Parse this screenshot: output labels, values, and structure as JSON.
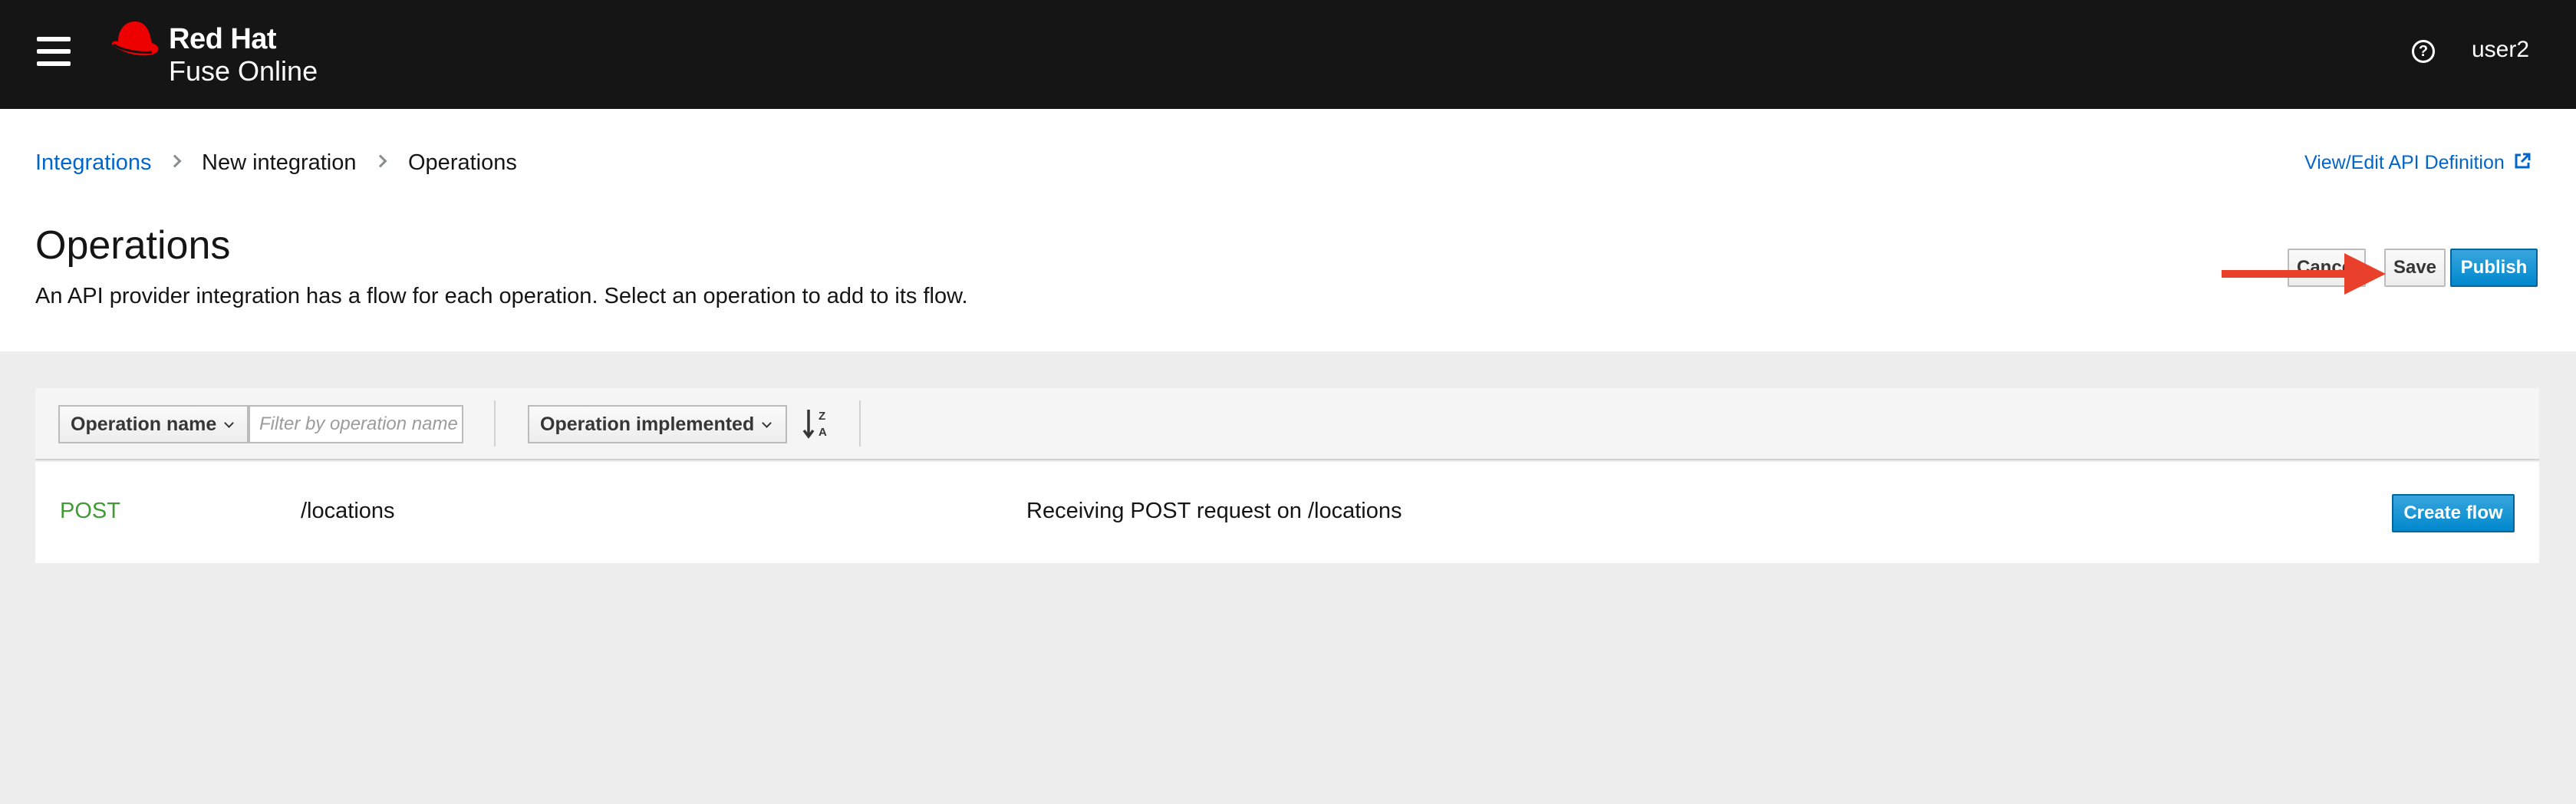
{
  "masthead": {
    "brand_line1": "Red Hat",
    "brand_line2": "Fuse Online",
    "help_icon_glyph": "?",
    "username": "user2"
  },
  "breadcrumb": {
    "items": [
      "Integrations",
      "New integration",
      "Operations"
    ],
    "view_edit_link": "View/Edit API Definition"
  },
  "page": {
    "title": "Operations",
    "description": "An API provider integration has a flow for each operation. Select an operation to add to its flow."
  },
  "actions": {
    "cancel_label": "Cancel",
    "save_label": "Save",
    "publish_label": "Publish"
  },
  "toolbar": {
    "filter_type": "Operation name",
    "filter_placeholder": "Filter by operation name",
    "sort_field": "Operation implemented",
    "sort_icon": "sort-alpha-desc-icon"
  },
  "operations": [
    {
      "method": "POST",
      "path": "/locations",
      "description": "Receiving POST request on /locations",
      "action_label": "Create flow"
    }
  ],
  "colors": {
    "masthead_bg": "#151515",
    "brand_red": "#ee0000",
    "link_blue": "#0066cc",
    "primary_blue": "#0088ce",
    "method_green": "#3f9c35",
    "annotation_arrow": "#e8402a"
  }
}
